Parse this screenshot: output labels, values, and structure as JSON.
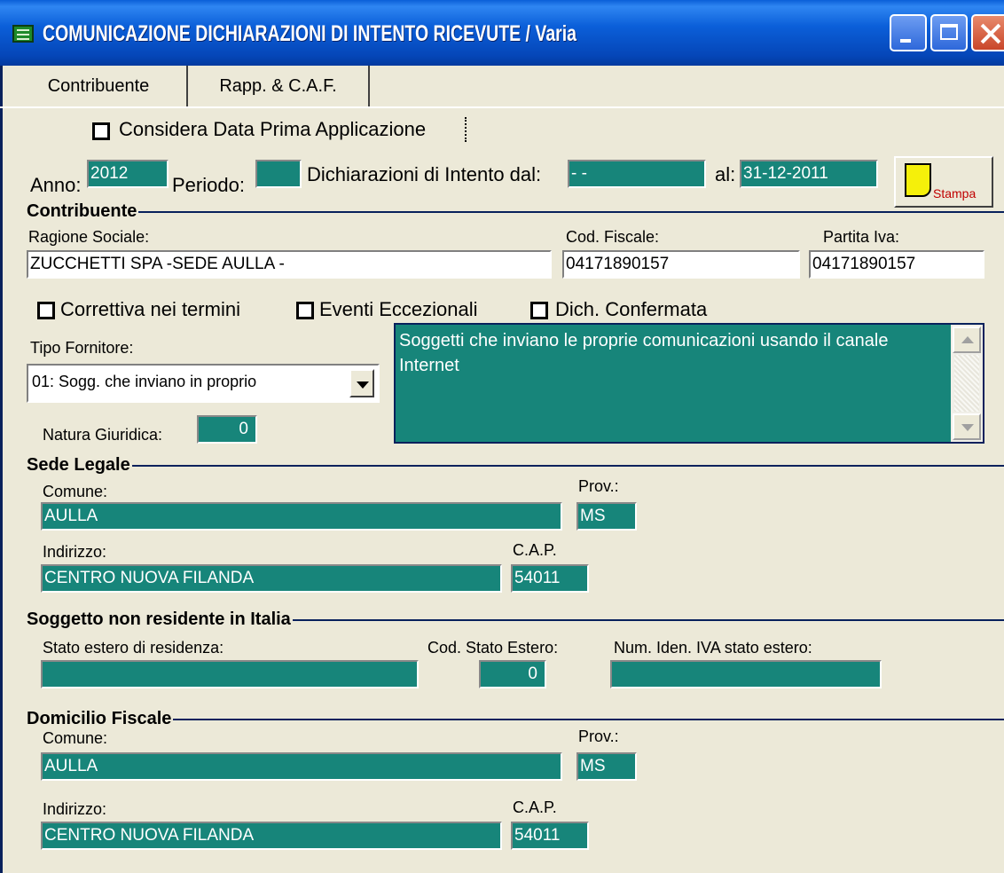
{
  "window": {
    "title": "COMUNICAZIONE DICHIARAZIONI DI INTENTO RICEVUTE / Varia"
  },
  "tabs": [
    {
      "label": "Contribuente"
    },
    {
      "label": "Rapp. & C.A.F."
    }
  ],
  "options": {
    "considera_label": "Considera Data Prima Applicazione"
  },
  "period": {
    "anno_label": "Anno:",
    "anno_value": "2012",
    "periodo_label": "Periodo:",
    "periodo_value": "",
    "dal_label": "Dichiarazioni di Intento dal:",
    "dal_value": " -  - ",
    "al_label": "al:",
    "al_value": "31-12-2011"
  },
  "toolbar": {
    "stampa_label": "Stampa"
  },
  "contribuente": {
    "section_title": "Contribuente",
    "ragione_label": "Ragione Sociale:",
    "ragione_value": "ZUCCHETTI SPA -SEDE AULLA -",
    "cf_label": "Cod. Fiscale:",
    "cf_value": "04171890157",
    "piva_label": "Partita Iva:",
    "piva_value": "04171890157",
    "correttiva_label": "Correttiva nei termini",
    "eventi_label": "Eventi Eccezionali",
    "confermata_label": "Dich. Confermata",
    "tipo_label": "Tipo Fornitore:",
    "tipo_value": "01: Sogg. che inviano in proprio",
    "tipo_description": "Soggetti che inviano le proprie comunicazioni usando il canale Internet",
    "natura_label": "Natura Giuridica:",
    "natura_value": "0"
  },
  "sede_legale": {
    "section_title": "Sede Legale",
    "comune_label": "Comune:",
    "comune_value": "AULLA",
    "prov_label": "Prov.:",
    "prov_value": "MS",
    "indirizzo_label": "Indirizzo:",
    "indirizzo_value": "CENTRO NUOVA FILANDA",
    "cap_label": "C.A.P.",
    "cap_value": "54011"
  },
  "non_residente": {
    "section_title": "Soggetto non residente in Italia",
    "stato_label": "Stato estero di residenza:",
    "stato_value": "",
    "cod_stato_label": "Cod. Stato Estero:",
    "cod_stato_value": "0",
    "num_iden_label": "Num. Iden. IVA stato estero:",
    "num_iden_value": ""
  },
  "domicilio": {
    "section_title": "Domicilio Fiscale",
    "comune_label": "Comune:",
    "comune_value": "AULLA",
    "prov_label": "Prov.:",
    "prov_value": "MS",
    "indirizzo_label": "Indirizzo:",
    "indirizzo_value": "CENTRO NUOVA FILANDA",
    "cap_label": "C.A.P.",
    "cap_value": "54011"
  },
  "colors": {
    "field_teal": "#17857a",
    "title_blue": "#0546b8",
    "section_line": "#08215c"
  }
}
